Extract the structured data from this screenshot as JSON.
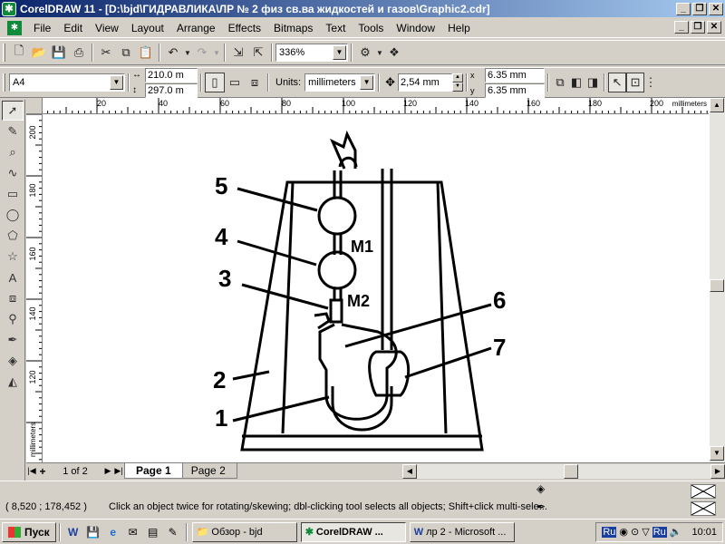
{
  "window": {
    "title": "CorelDRAW 11 - [D:\\bjd\\ГИДРАВЛИКА\\ЛР № 2 физ св.ва жидкостей и газов\\Graphic2.cdr]",
    "minimize": "_",
    "restore": "❐",
    "close": "✕"
  },
  "menu": [
    "File",
    "Edit",
    "View",
    "Layout",
    "Arrange",
    "Effects",
    "Bitmaps",
    "Text",
    "Tools",
    "Window",
    "Help"
  ],
  "toolbar": {
    "zoom": "336%"
  },
  "property_bar": {
    "paper_size": "A4",
    "width": "210.0 m",
    "height": "297.0 m",
    "units_label": "Units:",
    "units": "millimeters",
    "nudge": "2,54 mm",
    "dup_x_label": "x",
    "dup_y_label": "y",
    "dup_x": "6.35 mm",
    "dup_y": "6.35 mm"
  },
  "ruler": {
    "unit_label": "millimeters",
    "h_ticks": [
      "20",
      "40",
      "60",
      "80",
      "100",
      "120",
      "140",
      "160",
      "180",
      "200"
    ],
    "v_ticks": [
      "200",
      "180",
      "160",
      "140",
      "120"
    ]
  },
  "drawing": {
    "labels": [
      "5",
      "4",
      "3",
      "2",
      "1",
      "6",
      "7",
      "M1",
      "M2"
    ]
  },
  "pages": {
    "count_text": "1 of 2",
    "tabs": [
      "Page 1",
      "Page 2"
    ]
  },
  "status": {
    "coords": "( 8,520 ; 178,452 )",
    "hint": "Click an object twice for rotating/skewing; dbl-clicking tool selects all objects; Shift+click multi-sele..."
  },
  "taskbar": {
    "start": "Пуск",
    "tasks": [
      "Обзор - bjd",
      "CorelDRAW ...",
      "лр 2 - Microsoft ..."
    ],
    "lang1": "Ru",
    "lang2": "Ru",
    "time": "10:01"
  }
}
